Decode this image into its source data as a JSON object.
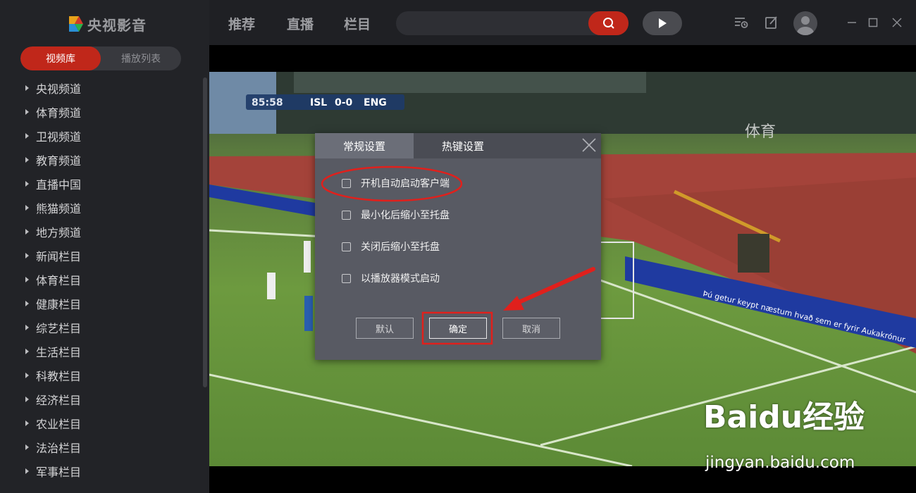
{
  "app": {
    "name": "央视影音"
  },
  "sidebar": {
    "tabs": [
      {
        "label": "视频库"
      },
      {
        "label": "播放列表"
      }
    ],
    "items": [
      {
        "label": "央视频道"
      },
      {
        "label": "体育频道"
      },
      {
        "label": "卫视频道"
      },
      {
        "label": "教育频道"
      },
      {
        "label": "直播中国"
      },
      {
        "label": "熊猫频道"
      },
      {
        "label": "地方频道"
      },
      {
        "label": "新闻栏目"
      },
      {
        "label": "体育栏目"
      },
      {
        "label": "健康栏目"
      },
      {
        "label": "综艺栏目"
      },
      {
        "label": "生活栏目"
      },
      {
        "label": "科教栏目"
      },
      {
        "label": "经济栏目"
      },
      {
        "label": "农业栏目"
      },
      {
        "label": "法治栏目"
      },
      {
        "label": "军事栏目"
      }
    ]
  },
  "topnav": {
    "items": [
      {
        "label": "推荐"
      },
      {
        "label": "直播"
      },
      {
        "label": "栏目"
      }
    ]
  },
  "search": {
    "value": "",
    "placeholder": ""
  },
  "video": {
    "score": {
      "time": "85:58",
      "home": "ISL",
      "score": "0-0",
      "away": "ENG"
    },
    "channel": "体育",
    "banner": "Þú getur keypt næstum hvað sem er fyrir Aukakrónur"
  },
  "dialog": {
    "tabs": [
      {
        "label": "常规设置"
      },
      {
        "label": "热键设置"
      }
    ],
    "options": [
      {
        "label": "开机自动启动客户端",
        "checked": false
      },
      {
        "label": "最小化后缩小至托盘",
        "checked": false
      },
      {
        "label": "关闭后缩小至托盘",
        "checked": false
      },
      {
        "label": "以播放器模式启动",
        "checked": false
      }
    ],
    "buttons": {
      "default": "默认",
      "ok": "确定",
      "cancel": "取消"
    }
  },
  "watermark": {
    "logo": "Baidu经验",
    "url": "jingyan.baidu.com"
  },
  "colors": {
    "accent": "#c0271a",
    "annotation": "#e0201c"
  }
}
